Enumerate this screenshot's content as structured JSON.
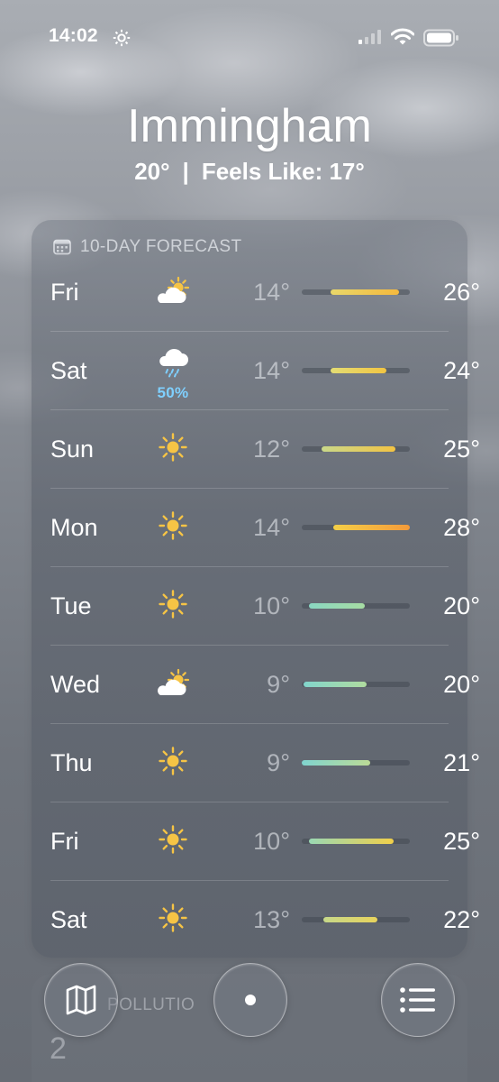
{
  "status_bar": {
    "time": "14:02",
    "icons": [
      "gear-icon",
      "signal-icon",
      "wifi-icon",
      "battery-icon"
    ]
  },
  "header": {
    "city": "Immingham",
    "temperature": "20°",
    "separator": "|",
    "feels_like": "Feels Like: 17°"
  },
  "forecast": {
    "title": "10-DAY FORECAST",
    "days": [
      {
        "day": "Fri",
        "icon": "partly-sunny-icon",
        "precip": "",
        "low": "14°",
        "high": "26°",
        "bar_start": 0.27,
        "bar_end": 0.9,
        "bar_colors": [
          "#e8d76a",
          "#f5b93d"
        ]
      },
      {
        "day": "Sat",
        "icon": "rain-icon",
        "precip": "50%",
        "low": "14°",
        "high": "24°",
        "bar_start": 0.27,
        "bar_end": 0.78,
        "bar_colors": [
          "#e3dc74",
          "#f2c542"
        ]
      },
      {
        "day": "Sun",
        "icon": "sun-icon",
        "precip": "",
        "low": "12°",
        "high": "25°",
        "bar_start": 0.18,
        "bar_end": 0.87,
        "bar_colors": [
          "#c9d88a",
          "#f3c343"
        ]
      },
      {
        "day": "Mon",
        "icon": "sun-icon",
        "precip": "",
        "low": "14°",
        "high": "28°",
        "bar_start": 0.29,
        "bar_end": 1.0,
        "bar_colors": [
          "#f3cf48",
          "#f39a3a"
        ]
      },
      {
        "day": "Tue",
        "icon": "sun-icon",
        "precip": "",
        "low": "10°",
        "high": "20°",
        "bar_start": 0.07,
        "bar_end": 0.58,
        "bar_colors": [
          "#8ad7c2",
          "#a7dca3"
        ]
      },
      {
        "day": "Wed",
        "icon": "partly-sunny-icon",
        "precip": "",
        "low": "9°",
        "high": "20°",
        "bar_start": 0.02,
        "bar_end": 0.6,
        "bar_colors": [
          "#82d5cc",
          "#b0dc9f"
        ]
      },
      {
        "day": "Thu",
        "icon": "sun-icon",
        "precip": "",
        "low": "9°",
        "high": "21°",
        "bar_start": 0.0,
        "bar_end": 0.63,
        "bar_colors": [
          "#80d4cf",
          "#bcdb96"
        ]
      },
      {
        "day": "Fri",
        "icon": "sun-icon",
        "precip": "",
        "low": "10°",
        "high": "25°",
        "bar_start": 0.07,
        "bar_end": 0.85,
        "bar_colors": [
          "#9ad8b4",
          "#f0cf4a"
        ]
      },
      {
        "day": "Sat",
        "icon": "sun-icon",
        "precip": "",
        "low": "13°",
        "high": "22°",
        "bar_start": 0.2,
        "bar_end": 0.7,
        "bar_colors": [
          "#c6d88a",
          "#e8d35c"
        ]
      }
    ]
  },
  "below": {
    "title": "POLLUTIO",
    "value": "2"
  },
  "bottom_bar": {
    "icons": [
      "map-icon",
      "current-location-dot",
      "list-icon"
    ]
  }
}
